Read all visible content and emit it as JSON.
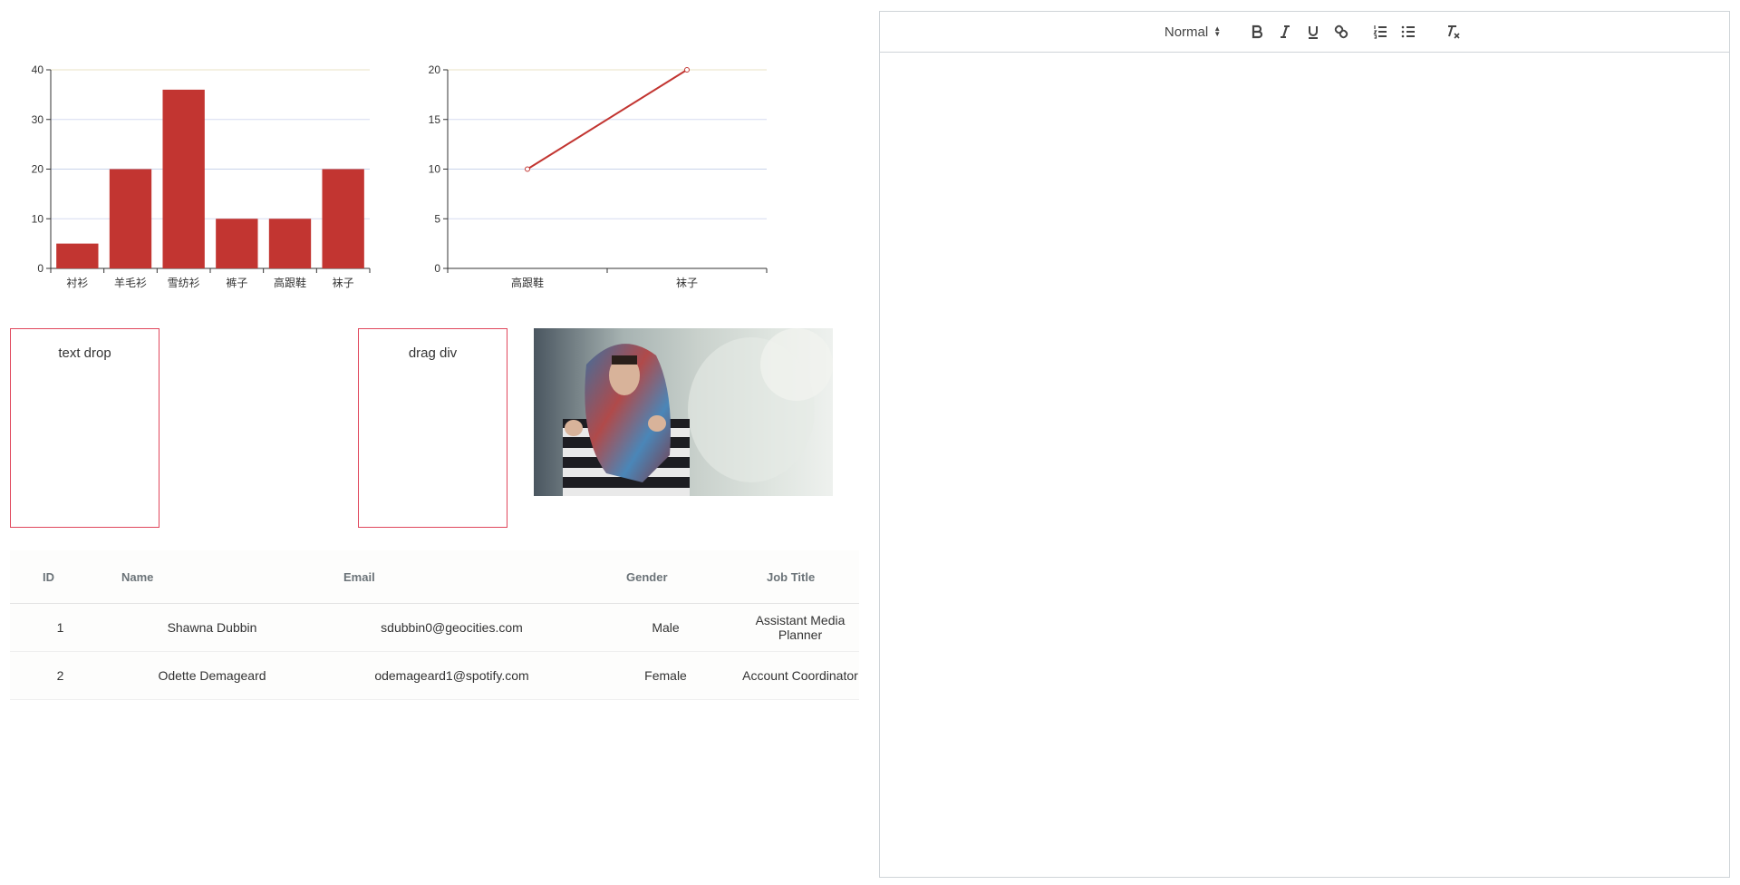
{
  "bar_chart": {
    "colors": {
      "bar": "#c23531",
      "grid": "#d9d9ee",
      "axis": "#333333"
    }
  },
  "line_chart": {
    "colors": {
      "line": "#c23531"
    }
  },
  "chart_data": [
    {
      "type": "bar",
      "categories": [
        "衬衫",
        "羊毛衫",
        "雪纺衫",
        "裤子",
        "高跟鞋",
        "袜子"
      ],
      "values": [
        5,
        20,
        36,
        10,
        10,
        20
      ],
      "ylim": [
        0,
        40
      ],
      "yticks": [
        0,
        10,
        20,
        30,
        40
      ],
      "grid": true
    },
    {
      "type": "line",
      "categories": [
        "高跟鞋",
        "袜子"
      ],
      "values": [
        10,
        20
      ],
      "ylim": [
        0,
        20
      ],
      "yticks": [
        0,
        5,
        10,
        15,
        20
      ],
      "grid": true
    }
  ],
  "drop_zones": {
    "text_drop": "text drop",
    "drag_div": "drag div"
  },
  "table": {
    "headers": [
      "ID",
      "Name",
      "Email",
      "Gender",
      "Job Title"
    ],
    "rows": [
      [
        "1",
        "Shawna Dubbin",
        "sdubbin0@geocities.com",
        "Male",
        "Assistant Media Planner"
      ],
      [
        "2",
        "Odette Demageard",
        "odemageard1@spotify.com",
        "Female",
        "Account Coordinator"
      ]
    ]
  },
  "editor": {
    "format_select": "Normal",
    "toolbar_icons": [
      "bold-icon",
      "italic-icon",
      "underline-icon",
      "link-icon",
      "ordered-list-icon",
      "bullet-list-icon",
      "clear-format-icon"
    ]
  }
}
